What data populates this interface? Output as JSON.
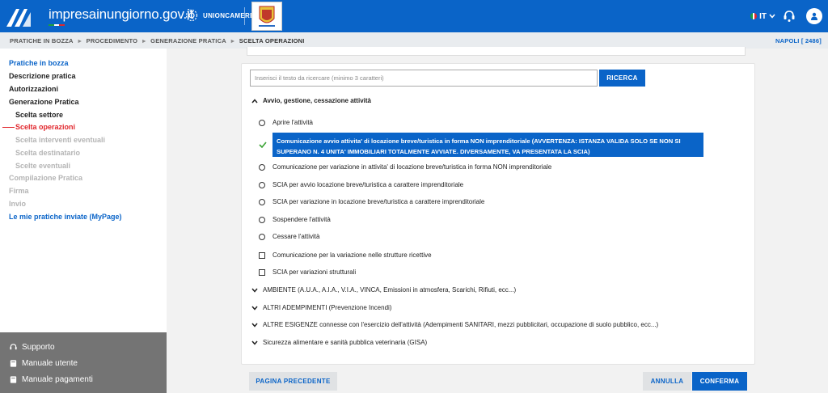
{
  "header": {
    "brand_normal": "impresainungiorno",
    "brand_bold": ".gov.it",
    "unioncamere": "UNIONCAMERE",
    "language": "IT",
    "colors": {
      "primary": "#0a64c8",
      "active_red": "#e1262c",
      "footer_gray": "#747474"
    }
  },
  "breadcrumb": {
    "items": [
      "PRATICHE IN BOZZA",
      "PROCEDIMENTO",
      "GENERAZIONE PRATICA",
      "SCELTA OPERAZIONI"
    ],
    "office": "NAPOLI [ 2486]"
  },
  "sidebar": {
    "items": [
      {
        "label": "Pratiche in bozza",
        "state": "link"
      },
      {
        "label": "Descrizione pratica",
        "state": "done"
      },
      {
        "label": "Autorizzazioni",
        "state": "done"
      },
      {
        "label": "Generazione Pratica",
        "state": "done"
      },
      {
        "label": "Scelta settore",
        "state": "done"
      },
      {
        "label": "Scelta operazioni",
        "state": "active"
      },
      {
        "label": "Scelta interventi eventuali",
        "state": "disabled"
      },
      {
        "label": "Scelta destinatario",
        "state": "disabled"
      },
      {
        "label": "Scelte eventuali",
        "state": "disabled"
      },
      {
        "label": "Compilazione Pratica",
        "state": "disabled"
      },
      {
        "label": "Firma",
        "state": "disabled"
      },
      {
        "label": "Invio",
        "state": "disabled"
      },
      {
        "label": "Le mie pratiche inviate (MyPage)",
        "state": "link"
      }
    ],
    "footer": [
      {
        "label": "Supporto",
        "icon": "support-icon"
      },
      {
        "label": "Manuale utente",
        "icon": "book-icon"
      },
      {
        "label": "Manuale pagamenti",
        "icon": "book-icon"
      }
    ]
  },
  "search": {
    "placeholder": "Inserisci il testo da ricercare (minimo 3 caratteri)",
    "value": "",
    "button": "RICERCA"
  },
  "section_open": {
    "title": "Avvio, gestione, cessazione attività",
    "icon": "chevron-up-icon"
  },
  "options": [
    {
      "label": "Aprire l'attività",
      "type": "radio",
      "selected": false
    },
    {
      "label": "Comunicazione avvio attivita' di locazione breve/turistica in forma NON imprenditoriale (AVVERTENZA: ISTANZA VALIDA SOLO SE NON SI SUPERANO N. 4 UNITA' IMMOBILIARI TOTALMENTE AVVIATE. DIVERSAMENTE, VA PRESENTATA LA SCIA)",
      "type": "radio",
      "selected": true,
      "icon": "check-icon"
    },
    {
      "label": "Comunicazione per variazione in attivita' di locazione breve/turistica in forma NON imprenditoriale",
      "type": "radio",
      "selected": false
    },
    {
      "label": "SCIA per avvio locazione breve/turistica a carattere imprenditoriale",
      "type": "radio",
      "selected": false
    },
    {
      "label": "SCIA per variazione in locazione breve/turistica a carattere imprenditoriale",
      "type": "radio",
      "selected": false
    },
    {
      "label": "Sospendere l'attività",
      "type": "radio",
      "selected": false
    },
    {
      "label": "Cessare l'attività",
      "type": "radio",
      "selected": false
    },
    {
      "label": "Comunicazione per la variazione nelle strutture ricettive",
      "type": "checkbox",
      "selected": false
    },
    {
      "label": "SCIA per variazioni strutturali",
      "type": "checkbox",
      "selected": false
    }
  ],
  "sections_collapsed": [
    {
      "title": "AMBIENTE (A.U.A., A.I.A., V.I.A., VINCA, Emissioni in atmosfera, Scarichi, Rifiuti, ecc...)",
      "icon": "chevron-down-icon"
    },
    {
      "title": "ALTRI ADEMPIMENTI (Prevenzione Incendi)",
      "icon": "chevron-down-icon"
    },
    {
      "title": "ALTRE ESIGENZE connesse con l'esercizio dell'attività (Adempimenti SANITARI, mezzi pubblicitari, occupazione di suolo pubblico, ecc...)",
      "icon": "chevron-down-icon"
    },
    {
      "title": "Sicurezza alimentare e sanità pubblica veterinaria (GISA)",
      "icon": "chevron-down-icon"
    }
  ],
  "buttons": {
    "previous": "PAGINA PRECEDENTE",
    "cancel": "ANNULLA",
    "confirm": "CONFERMA"
  }
}
